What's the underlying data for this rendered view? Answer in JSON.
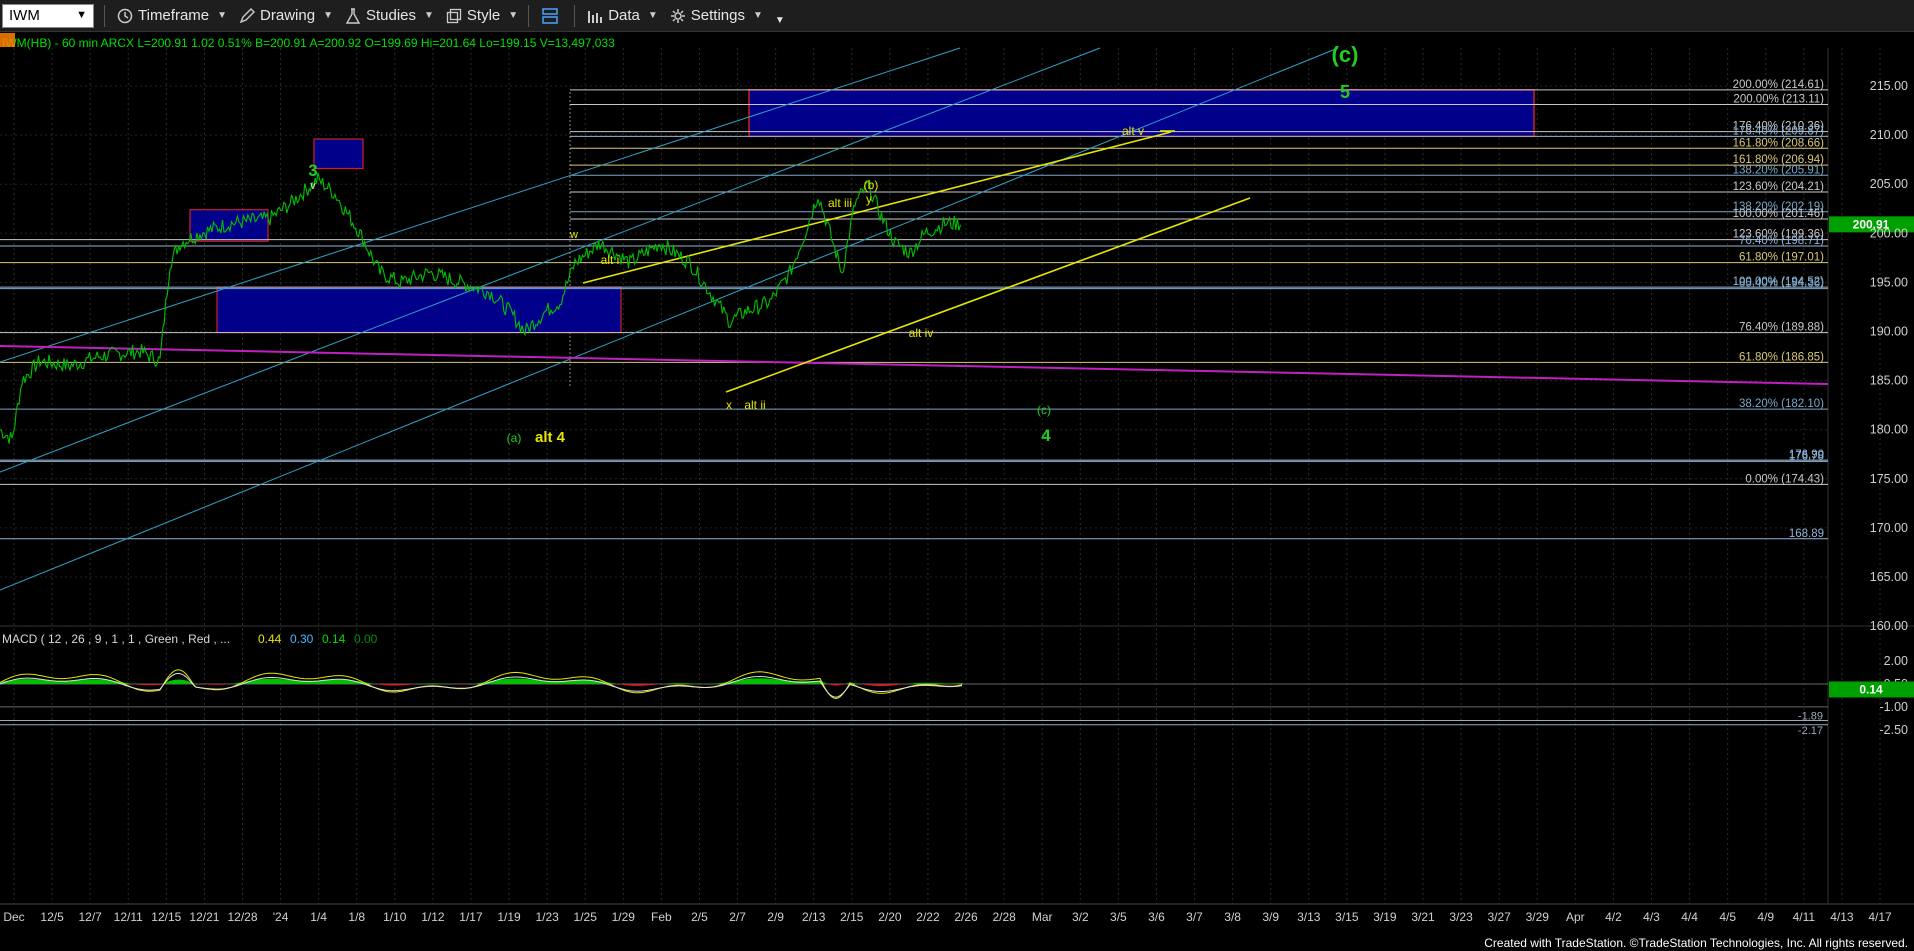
{
  "toolbar": {
    "symbol": "IWM",
    "timeframe": "Timeframe",
    "drawing": "Drawing",
    "studies": "Studies",
    "style": "Style",
    "data": "Data",
    "settings": "Settings"
  },
  "header": {
    "line": "IWM(HB) - 60 min  ARCX  L=200.91  1.02  0.51%  B=200.91  A=200.92  O=199.69  Hi=201.64  Lo=199.15  V=13,497,033"
  },
  "macd_header": {
    "title": "MACD ( 12 , 26 , 9 , 1 , 1 , Green , Red , ...",
    "v1": "0.44",
    "v2": "0.30",
    "v3": "0.14",
    "v4": "0.00"
  },
  "price_axis": {
    "ticks": [
      "215.00",
      "210.00",
      "205.00",
      "200.00",
      "195.00",
      "190.00",
      "185.00",
      "180.00",
      "175.00",
      "170.00",
      "165.00",
      "160.00"
    ],
    "last_price": "200.91"
  },
  "macd_axis": {
    "ticks": [
      "2.00",
      "0.50",
      "-1.00",
      "-2.50"
    ],
    "last_value": "0.14",
    "label_a": "-1.89",
    "label_b": "-2.17"
  },
  "date_axis": [
    "Dec",
    "12/5",
    "12/7",
    "12/11",
    "12/15",
    "12/21",
    "12/28",
    "'24",
    "1/4",
    "1/8",
    "1/10",
    "1/12",
    "1/17",
    "1/19",
    "1/23",
    "1/25",
    "1/29",
    "Feb",
    "2/5",
    "2/7",
    "2/9",
    "2/13",
    "2/15",
    "2/20",
    "2/22",
    "2/26",
    "2/28",
    "Mar",
    "3/2",
    "3/5",
    "3/6",
    "3/7",
    "3/8",
    "3/9",
    "3/13",
    "3/15",
    "3/19",
    "3/21",
    "3/23",
    "3/27",
    "3/29",
    "Apr",
    "4/2",
    "4/3",
    "4/4",
    "4/5",
    "4/9",
    "4/11",
    "4/13",
    "4/17"
  ],
  "fib_levels": [
    {
      "label": "200.00% (214.61)",
      "price": 214.61,
      "color": "#c8c8c8"
    },
    {
      "label": "200.00% (213.11)",
      "price": 213.11,
      "color": "#c8c8c8"
    },
    {
      "label": "176.40% (210.36)",
      "price": 210.36,
      "color": "#c8c8c8"
    },
    {
      "label": "176.40% (209.87)",
      "price": 209.87,
      "color": "#8fb4d8"
    },
    {
      "label": "161.80% (208.66)",
      "price": 208.66,
      "color": "#d8c878"
    },
    {
      "label": "161.80% (206.94)",
      "price": 206.94,
      "color": "#d8c878"
    },
    {
      "label": "138.20% (205.91)",
      "price": 205.91,
      "color": "#7aa8c8"
    },
    {
      "label": "123.60% (204.21)",
      "price": 204.21,
      "color": "#c8c8c8"
    },
    {
      "label": "138.20% (202.19)",
      "price": 202.19,
      "color": "#7aa8c8"
    },
    {
      "label": "100.00% (201.46)",
      "price": 201.46,
      "color": "#c8c8c8"
    },
    {
      "label": "123.60% (199.36)",
      "price": 199.36,
      "color": "#c8c8c8"
    },
    {
      "label": "76.40% (198.71)",
      "price": 198.71,
      "color": "#8fb4d8"
    },
    {
      "label": "61.80% (197.01)",
      "price": 197.01,
      "color": "#d8c878"
    },
    {
      "label": "100.00% (194.52)",
      "price": 194.52,
      "color": "#8fb4d8"
    },
    {
      "label": "85.40% (194.36)",
      "price": 194.36,
      "color": "#7aa8c8"
    },
    {
      "label": "76.40% (189.88)",
      "price": 189.88,
      "color": "#c8c8c8"
    },
    {
      "label": "61.80% (186.85)",
      "price": 186.85,
      "color": "#d8c878"
    },
    {
      "label": "38.20% (182.10)",
      "price": 182.1,
      "color": "#7aa8c8"
    },
    {
      "label": "176.78",
      "price": 176.78,
      "color": "#8fb4d8"
    },
    {
      "label": "176.90",
      "price": 176.9,
      "color": "#8fb4d8"
    },
    {
      "label": "0.00% (174.43)",
      "price": 174.43,
      "color": "#c8c8c8"
    },
    {
      "label": "168.89",
      "price": 168.89,
      "color": "#8fb4d8"
    }
  ],
  "wave_labels": {
    "c_top": "(c)",
    "five": "5",
    "three": "3",
    "v_small": "v",
    "w": "w",
    "alt_i": "alt i",
    "alt_iii": "alt iii",
    "b_paren": "(b)",
    "y": "y",
    "alt_v": "alt v",
    "alt_iv": "alt iv",
    "x": "x",
    "alt_ii": "alt ii",
    "a_paren": "(a)",
    "alt_4": "alt 4",
    "c_paren": "(c)",
    "four": "4"
  },
  "footer": "Created with TradeStation. ©TradeStation Technologies, Inc. All rights reserved.",
  "colors": {
    "up": "#00c000",
    "trend_cyan": "#2fa3c7",
    "trend_yellow": "#e6e600",
    "magenta": "#c020c0",
    "box_blue": "#00008b",
    "box_border": "#d02020",
    "wave_green": "#22cc22",
    "wave_yellow": "#e6e600"
  }
}
